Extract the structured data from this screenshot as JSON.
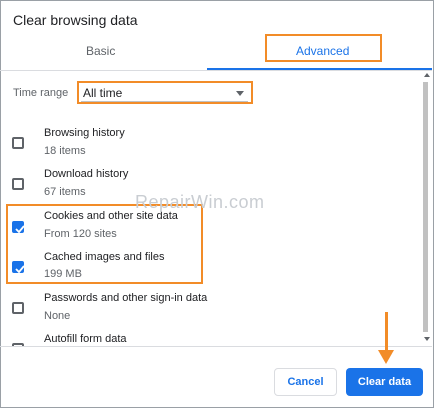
{
  "dialog": {
    "title": "Clear browsing data"
  },
  "tabs": [
    {
      "label": "Basic",
      "active": false
    },
    {
      "label": "Advanced",
      "active": true
    }
  ],
  "time_range": {
    "label": "Time range",
    "value": "All time"
  },
  "items": [
    {
      "label": "Browsing history",
      "sub": "18 items",
      "checked": false
    },
    {
      "label": "Download history",
      "sub": "67 items",
      "checked": false
    },
    {
      "label": "Cookies and other site data",
      "sub": "From 120 sites",
      "checked": true
    },
    {
      "label": "Cached images and files",
      "sub": "199 MB",
      "checked": true
    },
    {
      "label": "Passwords and other sign-in data",
      "sub": "None",
      "checked": false
    },
    {
      "label": "Autofill form data",
      "sub": "",
      "checked": false
    }
  ],
  "buttons": {
    "cancel": "Cancel",
    "clear": "Clear data"
  },
  "watermark": "RepairWin.com",
  "colors": {
    "accent": "#1a73e8",
    "annotation": "#f28c28"
  }
}
